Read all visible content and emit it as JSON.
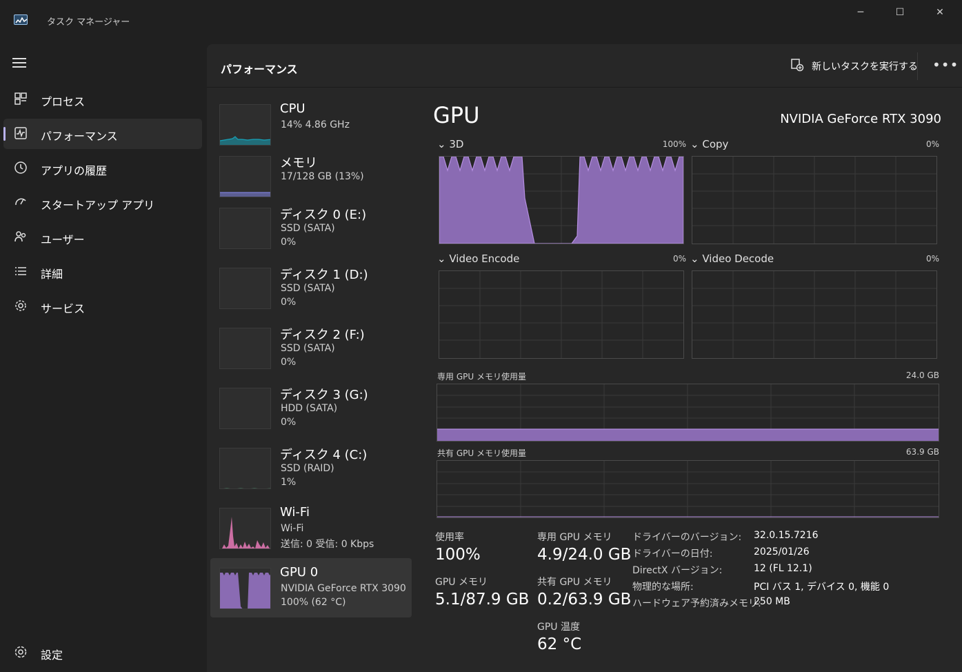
{
  "window": {
    "title": "タスク マネージャー",
    "minimize": "─",
    "maximize": "☐",
    "close": "✕"
  },
  "nav": {
    "menu_icon": "hamburger-icon",
    "items": [
      {
        "label": "プロセス",
        "icon": "processes-icon"
      },
      {
        "label": "パフォーマンス",
        "icon": "performance-icon",
        "active": true
      },
      {
        "label": "アプリの履歴",
        "icon": "history-icon"
      },
      {
        "label": "スタートアップ アプリ",
        "icon": "startup-icon"
      },
      {
        "label": "ユーザー",
        "icon": "users-icon"
      },
      {
        "label": "詳細",
        "icon": "details-icon"
      },
      {
        "label": "サービス",
        "icon": "services-icon"
      }
    ],
    "settings": {
      "label": "設定",
      "icon": "settings-icon"
    }
  },
  "header": {
    "title": "パフォーマンス",
    "run_task": "新しいタスクを実行する",
    "more": "•••"
  },
  "resources": [
    {
      "name": "CPU",
      "sub": "14% 4.86 GHz",
      "sub2": ""
    },
    {
      "name": "メモリ",
      "sub": "17/128 GB (13%)",
      "sub2": ""
    },
    {
      "name": "ディスク 0 (E:)",
      "sub": "SSD (SATA)",
      "sub2": "0%"
    },
    {
      "name": "ディスク 1 (D:)",
      "sub": "SSD (SATA)",
      "sub2": "0%"
    },
    {
      "name": "ディスク 2 (F:)",
      "sub": "SSD (SATA)",
      "sub2": "0%"
    },
    {
      "name": "ディスク 3 (G:)",
      "sub": "HDD (SATA)",
      "sub2": "0%"
    },
    {
      "name": "ディスク 4 (C:)",
      "sub": "SSD (RAID)",
      "sub2": "1%"
    },
    {
      "name": "Wi-Fi",
      "sub": "Wi-Fi",
      "sub2": "送信: 0 受信: 0 Kbps"
    },
    {
      "name": "GPU 0",
      "sub": "NVIDIA GeForce RTX 3090",
      "sub2": "100% (62 °C)",
      "active": true
    }
  ],
  "gpu": {
    "title": "GPU",
    "model": "NVIDIA GeForce RTX 3090",
    "engines": [
      {
        "label": "3D",
        "pct": "100%"
      },
      {
        "label": "Copy",
        "pct": "0%"
      },
      {
        "label": "Video Encode",
        "pct": "0%"
      },
      {
        "label": "Video Decode",
        "pct": "0%"
      }
    ],
    "dedicated_mem_label": "専用 GPU メモリ使用量",
    "dedicated_mem_max": "24.0 GB",
    "dedicated_mem_fraction": 0.204,
    "shared_mem_label": "共有 GPU メモリ使用量",
    "shared_mem_max": "63.9 GB",
    "shared_mem_fraction": 0.003,
    "stats": {
      "utilization_label": "使用率",
      "utilization": "100%",
      "gpu_mem_label": "GPU メモリ",
      "gpu_mem": "5.1/87.9 GB",
      "dedicated_label": "専用 GPU メモリ",
      "dedicated": "4.9/24.0 GB",
      "shared_label": "共有 GPU メモリ",
      "shared": "0.2/63.9 GB",
      "temp_label": "GPU 温度",
      "temp": "62 °C"
    },
    "info": [
      {
        "key": "ドライバーのバージョン:",
        "value": "32.0.15.7216"
      },
      {
        "key": "ドライバーの日付:",
        "value": "2025/01/26"
      },
      {
        "key": "DirectX バージョン:",
        "value": "12 (FL 12.1)"
      },
      {
        "key": "物理的な場所:",
        "value": "PCI バス 1, デバイス 0, 機能 0"
      },
      {
        "key": "ハードウェア予約済みメモリ:",
        "value": "250 MB"
      }
    ]
  },
  "colors": {
    "gpu_fill": "#8a6bb3",
    "gpu_line": "#b48ee0",
    "cpu_line": "#17a2b8",
    "mem_line": "#7b7fd6",
    "wifi": "#e879b7",
    "accent": "#b9b2ef"
  }
}
